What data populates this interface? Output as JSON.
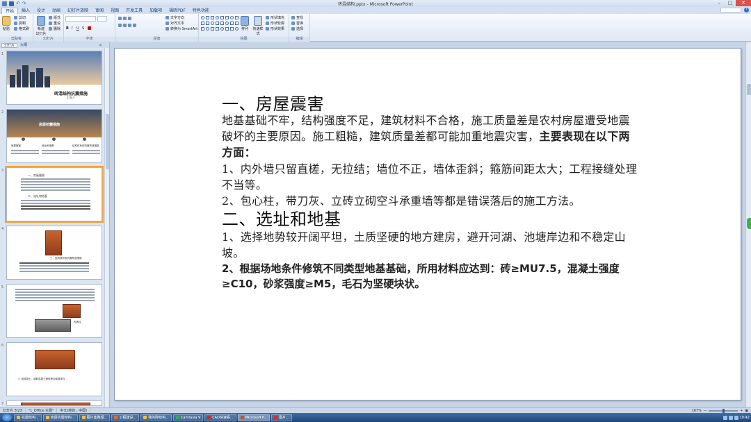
{
  "window": {
    "title": "砖混结构.pptx - Microsoft PowerPoint",
    "minimize": "–",
    "maximize": "□",
    "close": "✕"
  },
  "ribbon": {
    "tabs": [
      "开始",
      "插入",
      "设计",
      "动画",
      "幻灯片放映",
      "审阅",
      "视图",
      "开发工具",
      "加载项",
      "福昕PDF",
      "特色功能"
    ],
    "help": "?",
    "groups": {
      "clipboard": {
        "label": "剪贴板",
        "paste": "粘贴",
        "cut": "剪切",
        "copy": "复制",
        "format_painter": "格式刷"
      },
      "slides": {
        "label": "幻灯片",
        "new_slide": "新建\n幻灯片",
        "layout": "版式",
        "reset": "重设",
        "delete": "删除"
      },
      "font": {
        "label": "字体"
      },
      "paragraph": {
        "label": "段落",
        "text_direction": "文字方向",
        "align_text": "对齐文本",
        "smartart": "转换为 SmartArt"
      },
      "drawing": {
        "label": "绘图",
        "arrange": "排列",
        "quick_styles": "快速样式",
        "shape_fill": "形状填充",
        "shape_outline": "形状轮廓",
        "shape_effects": "形状效果"
      },
      "editing": {
        "label": "编辑",
        "find": "查找",
        "replace": "替换",
        "select": "选择"
      }
    }
  },
  "left_pane": {
    "tab_slides": "幻灯片",
    "tab_outline": "大纲",
    "close": "×",
    "thumbs": [
      {
        "num": "1",
        "title": "砖混结构抗震措施",
        "subtitle": "汇报人"
      },
      {
        "num": "2",
        "title": "房屋抗震措施",
        "items": [
          "房屋震害",
          "选址和地基",
          "结构体系和抗震构造措施"
        ]
      },
      {
        "num": "3",
        "heading": "一、房屋震害",
        "subheading": "二、选址和地基"
      },
      {
        "num": "4",
        "caption": "三、结构体系和抗震构造措施"
      },
      {
        "num": "5",
        "caption": "构造柱"
      },
      {
        "num": "6",
        "caption": "5. 用混凝土、钢筋混凝土墙体等加强整体性"
      },
      {
        "num": "7",
        "caption": ""
      }
    ]
  },
  "slide": {
    "heading1": "一、房屋震害",
    "para1_text": "地基基础不牢，结构强度不足，建筑材料不合格，施工质量差是农村房屋遭受地震破坏的主要原因。施工粗糙，建筑质量差都可能加重地震灾害，",
    "para1_bold": "主要表现在以下两方面：",
    "item1": "1、内外墙只留直槎，无拉结；墙位不正，墙体歪斜；箍筋间距太大；工程接缝处理不当等。",
    "item2": "2、包心柱，带刀灰、立砖立砌空斗承重墙等都是错误落后的施工方法。",
    "heading2": "二、选址和地基",
    "item3": "1、选择地势较开阔平坦，土质坚硬的地方建房，避开河湖、池塘岸边和不稳定山坡。",
    "item4": "2、根据场地条件修筑不同类型地基基础，所用材料应达到：砖≥MU7.5，混凝土强度≥C10，砂浆强度≥M5，毛石为坚硬块状。"
  },
  "statusbar": {
    "slide_count": "幻灯片 3/23",
    "theme": "\"1_Office 主题\"",
    "language": "中文(简体，中国)",
    "zoom": "167%"
  },
  "taskbar": {
    "items": [
      "抗震结构...",
      "房屋抗震结构...",
      "图片集整理...",
      "工程建设...",
      "我的砖结构...",
      "Camtasia 9",
      "CAD快速看...",
      "Microsoft P...",
      "图片..."
    ],
    "clock": "10:42"
  },
  "colors": {
    "accent": "#2d6ac4",
    "selected_thumb": "#f2a33a",
    "taskbar": "#1f4577"
  }
}
